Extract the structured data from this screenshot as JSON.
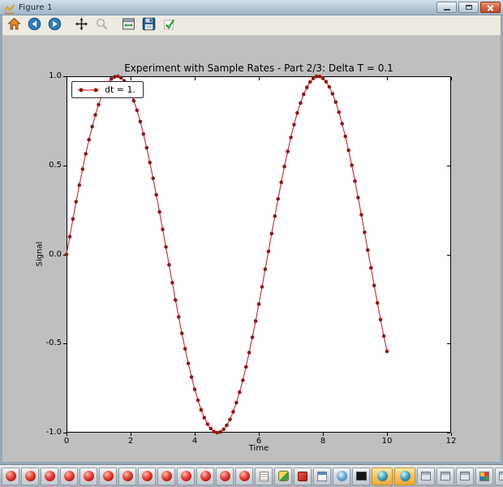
{
  "window": {
    "title": "Figure 1",
    "controls": [
      {
        "name": "minimize"
      },
      {
        "name": "maximize"
      },
      {
        "name": "close"
      }
    ]
  },
  "toolbar": {
    "buttons": [
      {
        "name": "home",
        "icon": "home-icon"
      },
      {
        "name": "back",
        "icon": "back-arrow-icon"
      },
      {
        "name": "forward",
        "icon": "forward-arrow-icon"
      },
      {
        "name": "pan",
        "icon": "pan-arrows-icon",
        "group_gap": true
      },
      {
        "name": "zoom",
        "icon": "zoom-magnifier-icon",
        "disabled": true
      },
      {
        "name": "configure-subplots",
        "icon": "subplots-icon",
        "group_gap": true
      },
      {
        "name": "save",
        "icon": "save-floppy-icon"
      },
      {
        "name": "confirm",
        "icon": "green-check-icon"
      }
    ]
  },
  "chart_data": {
    "type": "line",
    "title": "Experiment with Sample Rates - Part 2/3: Delta T = 0.1",
    "xlabel": "Time",
    "ylabel": "Signal",
    "legend_label": "dt = 1.",
    "legend_position": "upper left",
    "grid": false,
    "xlim": [
      0,
      12
    ],
    "ylim": [
      -1,
      1
    ],
    "x_ticks": [
      0,
      2,
      4,
      6,
      8,
      10,
      12
    ],
    "x_tick_labels": [
      "0",
      "2",
      "4",
      "6",
      "8",
      "10",
      "12"
    ],
    "y_ticks": [
      1.0,
      0.5,
      0.0,
      -0.5,
      -1.0
    ],
    "y_tick_labels": [
      "1.0",
      "0.5",
      "0.0",
      "-0.5",
      "-1.0"
    ],
    "line_color": "#c53b33",
    "marker_color": "#8e1a15",
    "marker": "circle",
    "t_start": 0.0,
    "t_step": 0.1,
    "y": [
      0.0,
      0.1,
      0.199,
      0.296,
      0.389,
      0.479,
      0.565,
      0.644,
      0.717,
      0.783,
      0.841,
      0.891,
      0.932,
      0.964,
      0.985,
      0.997,
      1.0,
      0.992,
      0.974,
      0.946,
      0.909,
      0.863,
      0.809,
      0.746,
      0.676,
      0.599,
      0.516,
      0.427,
      0.335,
      0.239,
      0.141,
      0.042,
      -0.058,
      -0.158,
      -0.256,
      -0.351,
      -0.443,
      -0.53,
      -0.612,
      -0.688,
      -0.757,
      -0.818,
      -0.872,
      -0.916,
      -0.952,
      -0.977,
      -0.994,
      -1.0,
      -0.996,
      -0.982,
      -0.959,
      -0.926,
      -0.883,
      -0.832,
      -0.773,
      -0.706,
      -0.631,
      -0.551,
      -0.465,
      -0.374,
      -0.279,
      -0.182,
      -0.083,
      0.017,
      0.117,
      0.215,
      0.312,
      0.405,
      0.494,
      0.578,
      0.657,
      0.729,
      0.794,
      0.85,
      0.899,
      0.938,
      0.968,
      0.988,
      0.999,
      0.999,
      0.989,
      0.97,
      0.941,
      0.902,
      0.855,
      0.798,
      0.734,
      0.663,
      0.585,
      0.501,
      0.412,
      0.319,
      0.223,
      0.124,
      0.025,
      -0.075,
      -0.174,
      -0.272,
      -0.366,
      -0.458,
      -0.544
    ]
  },
  "colors": {
    "figure_background": "#bfbfbf",
    "taskbar_active_button": "#f0a93c",
    "titlebar": "#b9cbd9"
  },
  "taskbar": {
    "buttons": [
      {
        "icon": "red-dot-icon"
      },
      {
        "icon": "red-dot-icon"
      },
      {
        "icon": "red-dot-icon"
      },
      {
        "icon": "red-dot-icon"
      },
      {
        "icon": "red-dot-icon"
      },
      {
        "icon": "red-dot-icon"
      },
      {
        "icon": "red-dot-icon"
      },
      {
        "icon": "red-dot-icon"
      },
      {
        "icon": "red-dot-icon"
      },
      {
        "icon": "red-dot-icon"
      },
      {
        "icon": "red-dot-icon"
      },
      {
        "icon": "red-dot-icon"
      },
      {
        "icon": "red-dot-icon"
      },
      {
        "icon": "notepad-icon"
      },
      {
        "icon": "python-icon"
      },
      {
        "icon": "red-app-icon"
      },
      {
        "icon": "document-icon"
      },
      {
        "icon": "globe-icon"
      },
      {
        "icon": "console-icon"
      },
      {
        "icon": "figure-blue-dot-icon",
        "active": true
      },
      {
        "icon": "figure-blue-dot-icon",
        "active": true
      },
      {
        "icon": "window-gray-icon"
      },
      {
        "icon": "window-gray-icon"
      },
      {
        "icon": "window-gray-icon"
      },
      {
        "icon": "picture-icon"
      },
      {
        "icon": "window-gray-icon"
      }
    ]
  }
}
